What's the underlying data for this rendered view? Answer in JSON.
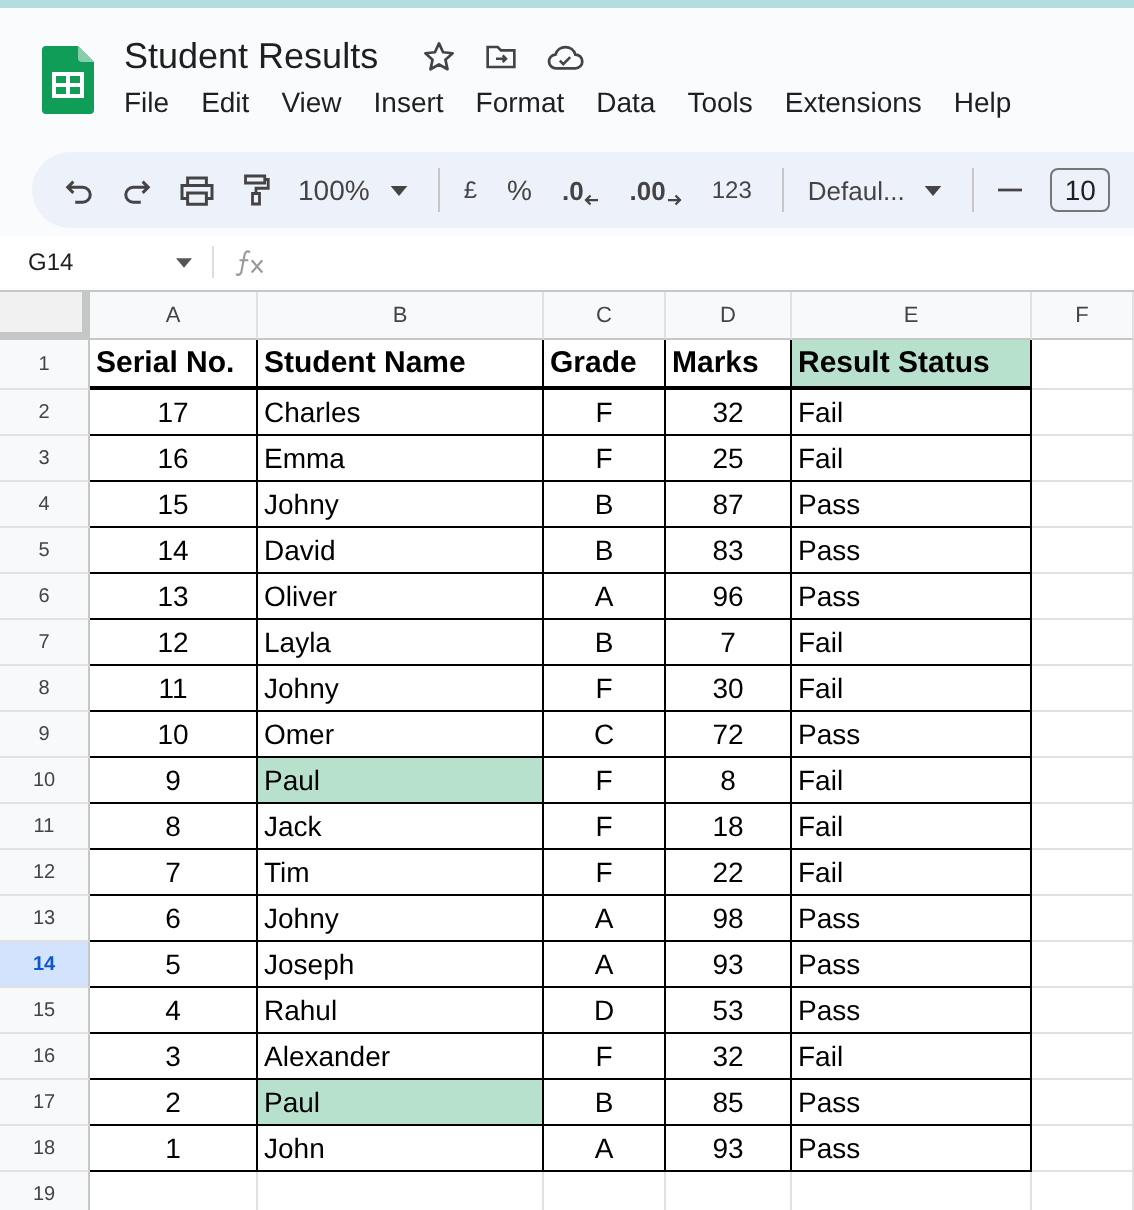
{
  "document": {
    "title": "Student Results"
  },
  "menu": [
    "File",
    "Edit",
    "View",
    "Insert",
    "Format",
    "Data",
    "Tools",
    "Extensions",
    "Help"
  ],
  "toolbar": {
    "zoom": "100%",
    "currency": "£",
    "percent": "%",
    "decrease_decimal": ".0",
    "increase_decimal": ".00",
    "number_format": "123",
    "font": "Defaul...",
    "font_size": "10"
  },
  "formula_bar": {
    "cell_ref": "G14"
  },
  "columns": [
    {
      "label": "A"
    },
    {
      "label": "B"
    },
    {
      "label": "C"
    },
    {
      "label": "D"
    },
    {
      "label": "E"
    },
    {
      "label": "F"
    }
  ],
  "header_row": {
    "number": "1",
    "cells": [
      {
        "text": "Serial No.",
        "highlight": false
      },
      {
        "text": "Student Name",
        "highlight": false
      },
      {
        "text": "Grade",
        "highlight": false
      },
      {
        "text": "Marks",
        "highlight": false
      },
      {
        "text": "Result Status",
        "highlight": true
      }
    ]
  },
  "rows": [
    {
      "number": "2",
      "selected": false,
      "serial": "17",
      "name": "Charles",
      "name_highlight": false,
      "grade": "F",
      "marks": "32",
      "status": "Fail"
    },
    {
      "number": "3",
      "selected": false,
      "serial": "16",
      "name": "Emma",
      "name_highlight": false,
      "grade": "F",
      "marks": "25",
      "status": "Fail"
    },
    {
      "number": "4",
      "selected": false,
      "serial": "15",
      "name": "Johny",
      "name_highlight": false,
      "grade": "B",
      "marks": "87",
      "status": "Pass"
    },
    {
      "number": "5",
      "selected": false,
      "serial": "14",
      "name": "David",
      "name_highlight": false,
      "grade": "B",
      "marks": "83",
      "status": "Pass"
    },
    {
      "number": "6",
      "selected": false,
      "serial": "13",
      "name": "Oliver",
      "name_highlight": false,
      "grade": "A",
      "marks": "96",
      "status": "Pass"
    },
    {
      "number": "7",
      "selected": false,
      "serial": "12",
      "name": "Layla",
      "name_highlight": false,
      "grade": "B",
      "marks": "7",
      "status": "Fail"
    },
    {
      "number": "8",
      "selected": false,
      "serial": "11",
      "name": "Johny",
      "name_highlight": false,
      "grade": "F",
      "marks": "30",
      "status": "Fail"
    },
    {
      "number": "9",
      "selected": false,
      "serial": "10",
      "name": "Omer",
      "name_highlight": false,
      "grade": "C",
      "marks": "72",
      "status": "Pass"
    },
    {
      "number": "10",
      "selected": false,
      "serial": "9",
      "name": "Paul",
      "name_highlight": true,
      "grade": "F",
      "marks": "8",
      "status": "Fail"
    },
    {
      "number": "11",
      "selected": false,
      "serial": "8",
      "name": "Jack",
      "name_highlight": false,
      "grade": "F",
      "marks": "18",
      "status": "Fail"
    },
    {
      "number": "12",
      "selected": false,
      "serial": "7",
      "name": "Tim",
      "name_highlight": false,
      "grade": "F",
      "marks": "22",
      "status": "Fail"
    },
    {
      "number": "13",
      "selected": false,
      "serial": "6",
      "name": "Johny",
      "name_highlight": false,
      "grade": "A",
      "marks": "98",
      "status": "Pass"
    },
    {
      "number": "14",
      "selected": true,
      "serial": "5",
      "name": "Joseph",
      "name_highlight": false,
      "grade": "A",
      "marks": "93",
      "status": "Pass"
    },
    {
      "number": "15",
      "selected": false,
      "serial": "4",
      "name": "Rahul",
      "name_highlight": false,
      "grade": "D",
      "marks": "53",
      "status": "Pass"
    },
    {
      "number": "16",
      "selected": false,
      "serial": "3",
      "name": "Alexander",
      "name_highlight": false,
      "grade": "F",
      "marks": "32",
      "status": "Fail"
    },
    {
      "number": "17",
      "selected": false,
      "serial": "2",
      "name": "Paul",
      "name_highlight": true,
      "grade": "B",
      "marks": "85",
      "status": "Pass"
    },
    {
      "number": "18",
      "selected": false,
      "serial": "1",
      "name": "John",
      "name_highlight": false,
      "grade": "A",
      "marks": "93",
      "status": "Pass"
    }
  ],
  "empty_rows": [
    {
      "number": "19"
    }
  ]
}
